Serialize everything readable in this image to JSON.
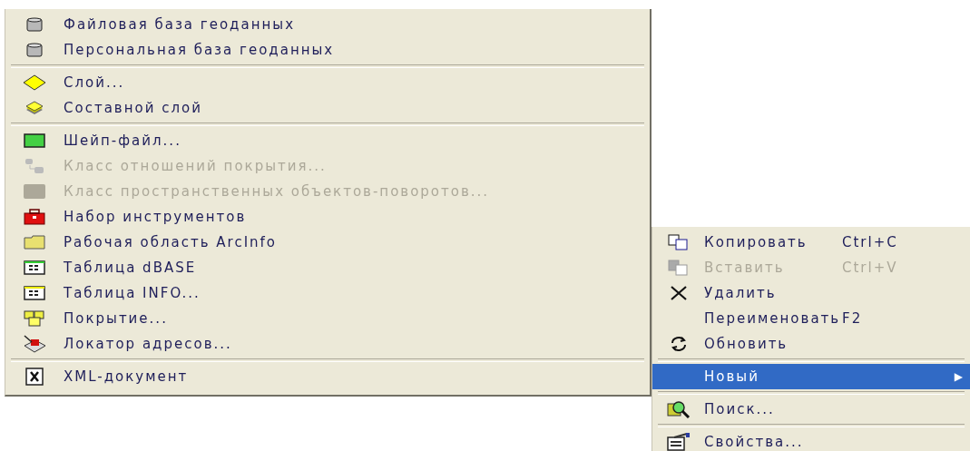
{
  "left_menu": {
    "items": [
      {
        "kind": "item",
        "label": "Файловая база геоданных",
        "disabled": false
      },
      {
        "kind": "item",
        "label": "Персональная база геоданных",
        "disabled": false
      },
      {
        "kind": "separator"
      },
      {
        "kind": "item",
        "label": "Слой...",
        "disabled": false
      },
      {
        "kind": "item",
        "label": "Составной слой",
        "disabled": false
      },
      {
        "kind": "separator"
      },
      {
        "kind": "item",
        "label": "Шейп-файл...",
        "disabled": false
      },
      {
        "kind": "item",
        "label": "Класс отношений покрытия...",
        "disabled": true
      },
      {
        "kind": "item",
        "label": "Класс пространственных объектов-поворотов...",
        "disabled": true
      },
      {
        "kind": "item",
        "label": "Набор инструментов",
        "disabled": false
      },
      {
        "kind": "item",
        "label": "Рабочая область ArcInfo",
        "disabled": false
      },
      {
        "kind": "item",
        "label": "Таблица dBASE",
        "disabled": false
      },
      {
        "kind": "item",
        "label": "Таблица INFO...",
        "disabled": false
      },
      {
        "kind": "item",
        "label": "Покрытие...",
        "disabled": false
      },
      {
        "kind": "item",
        "label": "Локатор адресов...",
        "disabled": false
      },
      {
        "kind": "separator"
      },
      {
        "kind": "item",
        "label": "XML-документ",
        "disabled": false
      }
    ]
  },
  "context_menu": {
    "items": [
      {
        "kind": "item",
        "label": "Копировать",
        "shortcut": "Ctrl+C",
        "disabled": false,
        "selected": false
      },
      {
        "kind": "item",
        "label": "Вставить",
        "shortcut": "Ctrl+V",
        "disabled": true,
        "selected": false
      },
      {
        "kind": "item",
        "label": "Удалить",
        "disabled": false,
        "selected": false
      },
      {
        "kind": "item",
        "label": "Переименовать",
        "shortcut": "F2",
        "disabled": false,
        "selected": false
      },
      {
        "kind": "item",
        "label": "Обновить",
        "disabled": false,
        "selected": false
      },
      {
        "kind": "separator"
      },
      {
        "kind": "submenu",
        "label": "Новый",
        "arrow": "▶",
        "disabled": false,
        "selected": true
      },
      {
        "kind": "separator"
      },
      {
        "kind": "item",
        "label": "Поиск...",
        "disabled": false,
        "selected": false
      },
      {
        "kind": "separator"
      },
      {
        "kind": "item",
        "label": "Свойства...",
        "disabled": false,
        "selected": false
      }
    ]
  }
}
